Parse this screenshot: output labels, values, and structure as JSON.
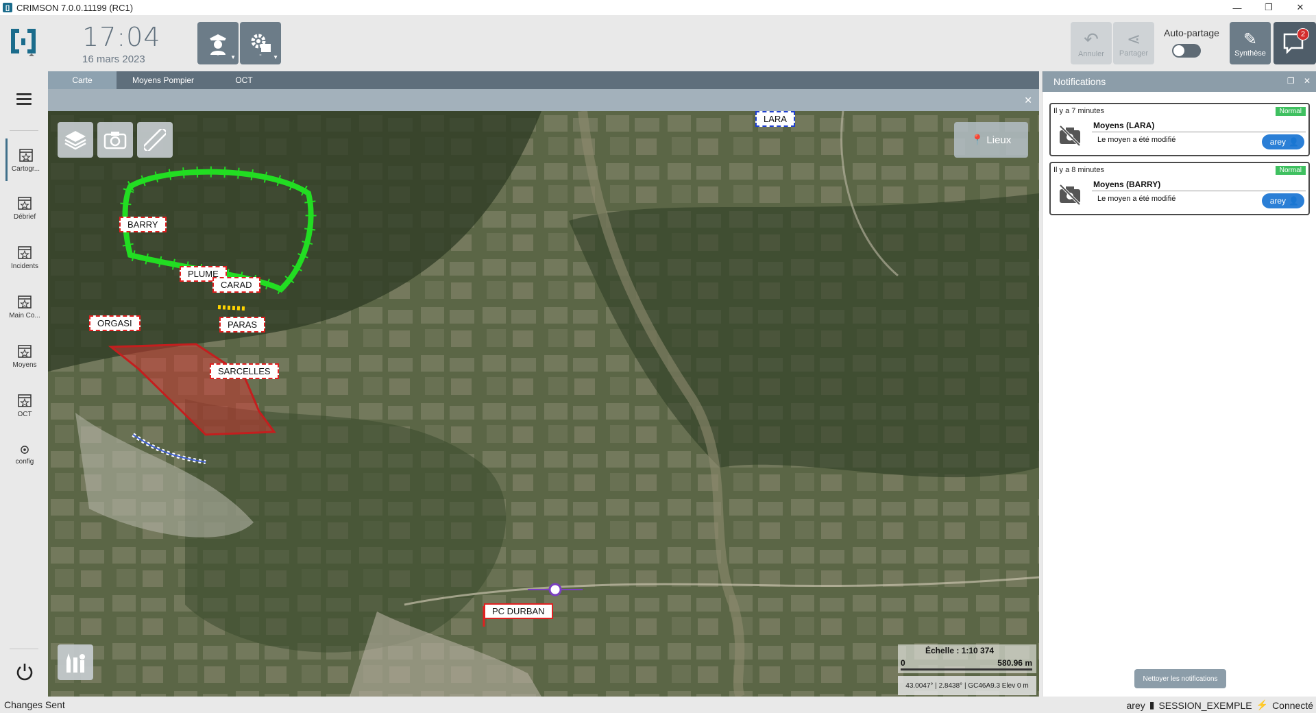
{
  "window": {
    "title": "CRIMSON 7.0.0.11199 (RC1)"
  },
  "header": {
    "time": "17:04",
    "date": "16 mars 2023",
    "btn1_sub": "-",
    "btn2_sub": "-",
    "annuler_label": "Annuler",
    "partager_label": "Partager",
    "autopartage_label": "Auto-partage",
    "synthese_label": "Synthèse",
    "notif_count": "2"
  },
  "sidebar": {
    "items": [
      {
        "label": "Cartogr..."
      },
      {
        "label": "Débrief"
      },
      {
        "label": "Incidents"
      },
      {
        "label": "Main Co..."
      },
      {
        "label": "Moyens"
      },
      {
        "label": "OCT"
      },
      {
        "label": "config"
      }
    ]
  },
  "tabs": [
    {
      "label": "Carte"
    },
    {
      "label": "Moyens Pompier"
    },
    {
      "label": "OCT"
    }
  ],
  "map": {
    "lieux_label": "Lieux",
    "labels": {
      "barry": "BARRY",
      "plume": "PLUME",
      "carad": "CARAD",
      "orgasi": "ORGASI",
      "paras": "PARAS",
      "sarcelles": "SARCELLES",
      "lara": "LARA",
      "pc_durban": "PC DURBAN"
    },
    "scale_title": "Échelle : 1:10 374",
    "scale_min": "0",
    "scale_max": "580.96 m",
    "coords": "43.0047° | 2.8438° | GC46A9.3 Elev 0 m"
  },
  "notifications": {
    "title": "Notifications",
    "clean_label": "Nettoyer les notifications",
    "items": [
      {
        "time": "Il y a 7 minutes",
        "priority": "Normal",
        "title": "Moyens (LARA)",
        "message": "Le moyen a été modifié",
        "user": "arey"
      },
      {
        "time": "Il y a 8 minutes",
        "priority": "Normal",
        "title": "Moyens (BARRY)",
        "message": "Le moyen a été modifié",
        "user": "arey"
      }
    ]
  },
  "status": {
    "left": "Changes Sent",
    "user": "arey",
    "session": "SESSION_EXEMPLE",
    "connection": "Connecté"
  },
  "colors": {
    "accent": "#5f6f7c",
    "normal_badge": "#3fc060",
    "user_pill": "#2b7fd6",
    "fire_zone": "#e03030",
    "green_zone": "#22dd22"
  }
}
